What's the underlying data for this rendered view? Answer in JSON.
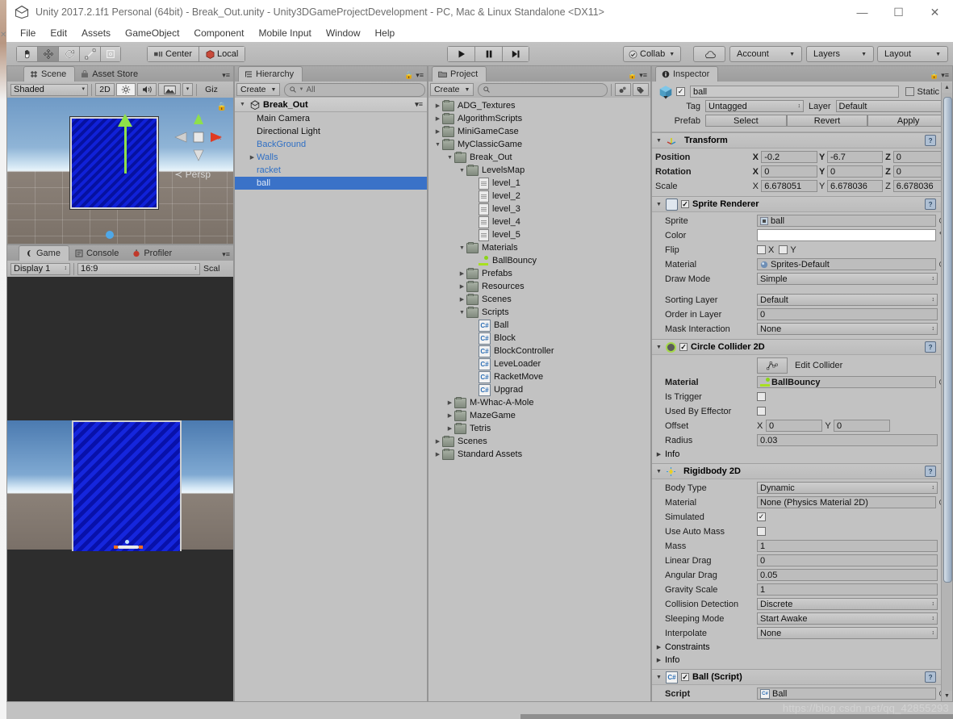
{
  "window": {
    "title": "Unity 2017.2.1f1 Personal (64bit) - Break_Out.unity - Unity3DGameProjectDevelopment - PC, Mac & Linux Standalone <DX11>",
    "minimize": "—",
    "maximize": "☐",
    "close": "✕"
  },
  "menubar": {
    "items": [
      "File",
      "Edit",
      "Assets",
      "GameObject",
      "Component",
      "Mobile Input",
      "Window",
      "Help"
    ]
  },
  "toolbar": {
    "tools": [
      "hand-tool",
      "move-tool",
      "rotate-tool",
      "scale-tool",
      "rect-tool"
    ],
    "pivot_label": "Center",
    "space_label": "Local",
    "play": "▶",
    "pause": "❘❘",
    "step": "▶❘",
    "collab_label": "Collab",
    "cloud_label": "cloud-icon",
    "account_label": "Account",
    "layers_label": "Layers",
    "layout_label": "Layout"
  },
  "scene_panel": {
    "tabs": [
      {
        "label": "Scene",
        "icon": "grid-icon",
        "active": true
      },
      {
        "label": "Asset Store",
        "icon": "store-icon",
        "active": false
      }
    ],
    "shading_mode": "Shaded",
    "view_2d": "2D",
    "lighting": "sun-icon",
    "audio": "speaker-icon",
    "fx": "image-icon",
    "gizmos_label": "Giz",
    "perspective_label": "Persp",
    "axis_labels": {
      "y": "y",
      "x": "x"
    }
  },
  "game_panel": {
    "tabs": [
      {
        "label": "Game",
        "icon": "gamepad-icon",
        "active": true
      },
      {
        "label": "Console",
        "icon": "console-icon",
        "active": false
      },
      {
        "label": "Profiler",
        "icon": "profiler-icon",
        "active": false
      }
    ],
    "display": "Display 1",
    "aspect": "16:9",
    "scale_label": "Scal"
  },
  "hierarchy": {
    "tab_label": "Hierarchy",
    "create_label": "Create",
    "search_placeholder": "All",
    "scene_name": "Break_Out",
    "items": [
      {
        "label": "Main Camera",
        "depth": 1,
        "arrow": "",
        "prefab": false,
        "selected": false
      },
      {
        "label": "Directional Light",
        "depth": 1,
        "arrow": "",
        "prefab": false,
        "selected": false
      },
      {
        "label": "BackGround",
        "depth": 1,
        "arrow": "",
        "prefab": true,
        "selected": false
      },
      {
        "label": "Walls",
        "depth": 1,
        "arrow": "▶",
        "prefab": true,
        "selected": false
      },
      {
        "label": "racket",
        "depth": 1,
        "arrow": "",
        "prefab": true,
        "selected": false
      },
      {
        "label": "ball",
        "depth": 1,
        "arrow": "",
        "prefab": true,
        "selected": true
      }
    ]
  },
  "project": {
    "tab_label": "Project",
    "create_label": "Create",
    "search_placeholder": "",
    "items": [
      {
        "label": "ADG_Textures",
        "depth": 0,
        "arrow": "▶",
        "icon": "folder"
      },
      {
        "label": "AlgorithmScripts",
        "depth": 0,
        "arrow": "▶",
        "icon": "folder"
      },
      {
        "label": "MiniGameCase",
        "depth": 0,
        "arrow": "▶",
        "icon": "folder"
      },
      {
        "label": "MyClassicGame",
        "depth": 0,
        "arrow": "▼",
        "icon": "folder"
      },
      {
        "label": "Break_Out",
        "depth": 1,
        "arrow": "▼",
        "icon": "folder"
      },
      {
        "label": "LevelsMap",
        "depth": 2,
        "arrow": "▼",
        "icon": "folder"
      },
      {
        "label": "level_1",
        "depth": 3,
        "arrow": "",
        "icon": "doc"
      },
      {
        "label": "level_2",
        "depth": 3,
        "arrow": "",
        "icon": "doc"
      },
      {
        "label": "level_3",
        "depth": 3,
        "arrow": "",
        "icon": "doc"
      },
      {
        "label": "level_4",
        "depth": 3,
        "arrow": "",
        "icon": "doc"
      },
      {
        "label": "level_5",
        "depth": 3,
        "arrow": "",
        "icon": "doc"
      },
      {
        "label": "Materials",
        "depth": 2,
        "arrow": "▼",
        "icon": "folder"
      },
      {
        "label": "BallBouncy",
        "depth": 3,
        "arrow": "",
        "icon": "material"
      },
      {
        "label": "Prefabs",
        "depth": 2,
        "arrow": "▶",
        "icon": "folder"
      },
      {
        "label": "Resources",
        "depth": 2,
        "arrow": "▶",
        "icon": "folder"
      },
      {
        "label": "Scenes",
        "depth": 2,
        "arrow": "▶",
        "icon": "folder"
      },
      {
        "label": "Scripts",
        "depth": 2,
        "arrow": "▼",
        "icon": "folder"
      },
      {
        "label": "Ball",
        "depth": 3,
        "arrow": "",
        "icon": "cs"
      },
      {
        "label": "Block",
        "depth": 3,
        "arrow": "",
        "icon": "cs"
      },
      {
        "label": "BlockController",
        "depth": 3,
        "arrow": "",
        "icon": "cs"
      },
      {
        "label": "LeveLoader",
        "depth": 3,
        "arrow": "",
        "icon": "cs"
      },
      {
        "label": "RacketMove",
        "depth": 3,
        "arrow": "",
        "icon": "cs"
      },
      {
        "label": "Upgrad",
        "depth": 3,
        "arrow": "",
        "icon": "cs"
      },
      {
        "label": "M-Whac-A-Mole",
        "depth": 1,
        "arrow": "▶",
        "icon": "folder"
      },
      {
        "label": "MazeGame",
        "depth": 1,
        "arrow": "▶",
        "icon": "folder"
      },
      {
        "label": "Tetris",
        "depth": 1,
        "arrow": "▶",
        "icon": "folder"
      },
      {
        "label": "Scenes",
        "depth": 0,
        "arrow": "▶",
        "icon": "folder"
      },
      {
        "label": "Standard Assets",
        "depth": 0,
        "arrow": "▶",
        "icon": "folder"
      }
    ]
  },
  "inspector": {
    "tab_label": "Inspector",
    "object_name": "ball",
    "enabled": true,
    "static_label": "Static",
    "tag_label": "Tag",
    "tag_value": "Untagged",
    "layer_label": "Layer",
    "layer_value": "Default",
    "prefab_label": "Prefab",
    "prefab_select": "Select",
    "prefab_revert": "Revert",
    "prefab_apply": "Apply",
    "transform": {
      "title": "Transform",
      "position_label": "Position",
      "position": {
        "x": "-0.2",
        "y": "-6.7",
        "z": "0"
      },
      "rotation_label": "Rotation",
      "rotation": {
        "x": "0",
        "y": "0",
        "z": "0"
      },
      "scale_label": "Scale",
      "scale": {
        "x": "6.678051",
        "y": "6.678036",
        "z": "6.678036"
      }
    },
    "sprite_renderer": {
      "title": "Sprite Renderer",
      "enabled": true,
      "sprite_label": "Sprite",
      "sprite_value": "ball",
      "color_label": "Color",
      "color_value": "#FFFFFF",
      "flip_label": "Flip",
      "flip_x_label": "X",
      "flip_y_label": "Y",
      "flip_x": false,
      "flip_y": false,
      "material_label": "Material",
      "material_value": "Sprites-Default",
      "draw_mode_label": "Draw Mode",
      "draw_mode_value": "Simple",
      "sorting_layer_label": "Sorting Layer",
      "sorting_layer_value": "Default",
      "order_in_layer_label": "Order in Layer",
      "order_in_layer_value": "0",
      "mask_interaction_label": "Mask Interaction",
      "mask_interaction_value": "None"
    },
    "circle_collider": {
      "title": "Circle Collider 2D",
      "enabled": true,
      "edit_collider_label": "Edit Collider",
      "material_label": "Material",
      "material_value": "BallBouncy",
      "is_trigger_label": "Is Trigger",
      "is_trigger": false,
      "used_by_effector_label": "Used By Effector",
      "used_by_effector": false,
      "offset_label": "Offset",
      "offset": {
        "x": "0",
        "y": "0"
      },
      "radius_label": "Radius",
      "radius_value": "0.03",
      "info_label": "Info"
    },
    "rigidbody": {
      "title": "Rigidbody 2D",
      "body_type_label": "Body Type",
      "body_type_value": "Dynamic",
      "material_label": "Material",
      "material_value": "None (Physics Material 2D)",
      "simulated_label": "Simulated",
      "simulated": true,
      "use_auto_mass_label": "Use Auto Mass",
      "use_auto_mass": false,
      "mass_label": "Mass",
      "mass_value": "1",
      "linear_drag_label": "Linear Drag",
      "linear_drag_value": "0",
      "angular_drag_label": "Angular Drag",
      "angular_drag_value": "0.05",
      "gravity_scale_label": "Gravity Scale",
      "gravity_scale_value": "1",
      "collision_detection_label": "Collision Detection",
      "collision_detection_value": "Discrete",
      "sleeping_mode_label": "Sleeping Mode",
      "sleeping_mode_value": "Start Awake",
      "interpolate_label": "Interpolate",
      "interpolate_value": "None",
      "constraints_label": "Constraints",
      "info_label": "Info"
    },
    "ball_script": {
      "title": "Ball (Script)",
      "enabled": true,
      "script_label": "Script",
      "script_value": "Ball"
    }
  },
  "watermark": "https://blog.csdn.net/qq_42855293"
}
